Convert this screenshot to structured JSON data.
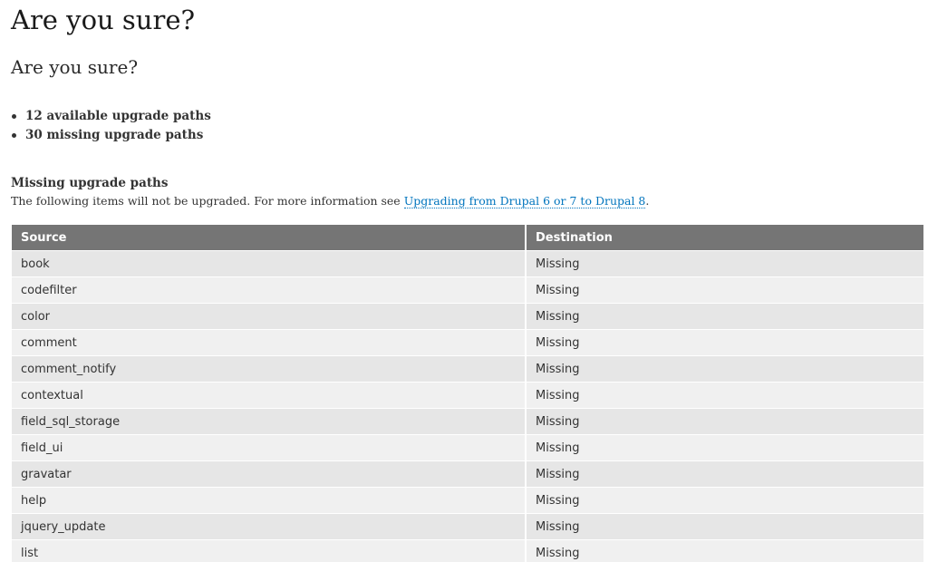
{
  "page": {
    "title": "Are you sure?",
    "subtitle": "Are you sure?"
  },
  "summary": {
    "items": [
      {
        "label": "12 available upgrade paths"
      },
      {
        "label": "30 missing upgrade paths"
      }
    ]
  },
  "missing_section": {
    "heading": "Missing upgrade paths",
    "description_prefix": "The following items will not be upgraded. For more information see ",
    "link_text": "Upgrading from Drupal 6 or 7 to Drupal 8",
    "description_suffix": "."
  },
  "table": {
    "headers": {
      "source": "Source",
      "destination": "Destination"
    },
    "rows": [
      {
        "source": "book",
        "destination": "Missing"
      },
      {
        "source": "codefilter",
        "destination": "Missing"
      },
      {
        "source": "color",
        "destination": "Missing"
      },
      {
        "source": "comment",
        "destination": "Missing"
      },
      {
        "source": "comment_notify",
        "destination": "Missing"
      },
      {
        "source": "contextual",
        "destination": "Missing"
      },
      {
        "source": "field_sql_storage",
        "destination": "Missing"
      },
      {
        "source": "field_ui",
        "destination": "Missing"
      },
      {
        "source": "gravatar",
        "destination": "Missing"
      },
      {
        "source": "help",
        "destination": "Missing"
      },
      {
        "source": "jquery_update",
        "destination": "Missing"
      },
      {
        "source": "list",
        "destination": "Missing"
      }
    ]
  },
  "colors": {
    "header_background": "#757575",
    "row_odd": "#e6e6e6",
    "row_even": "#f0f0f0",
    "link": "#0074bd"
  }
}
